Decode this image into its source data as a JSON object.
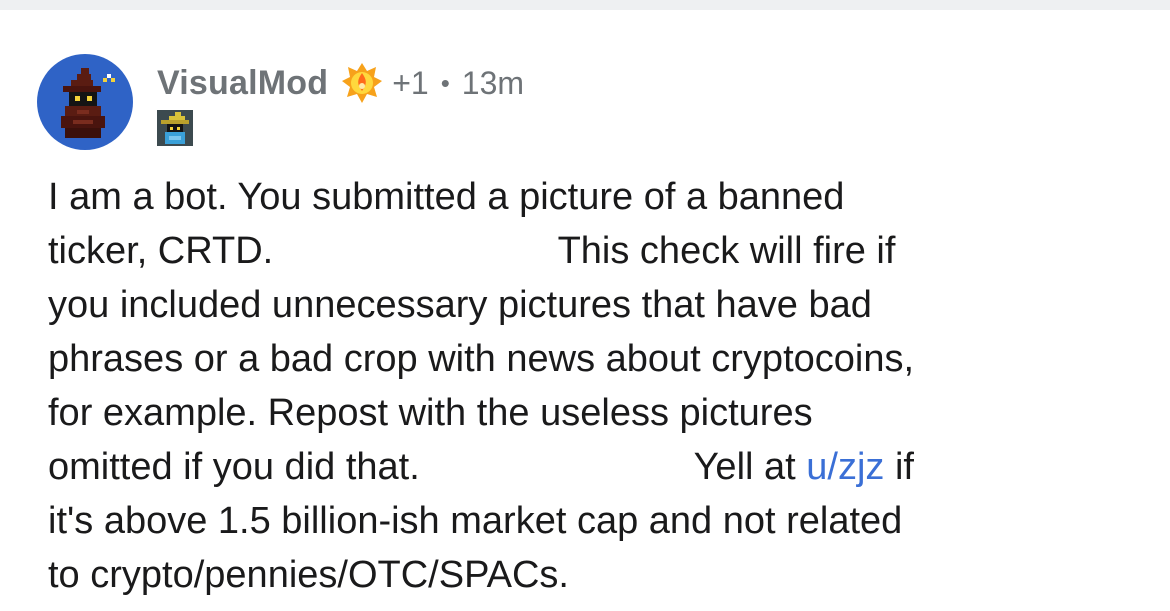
{
  "comment": {
    "username": "VisualMod",
    "award_count": "+1",
    "separator": "•",
    "timestamp": "13m",
    "avatar_icon": "black-mage-avatar-icon",
    "award_icon": "wholesome-seal-award-icon",
    "flair_icon": "black-mage-flair-icon",
    "avatar_bg": "#2f63c6",
    "link_color": "#3a6fd6",
    "body_lines": [
      "I am a bot. You submitted a picture of a banned",
      "ticker, CRTD.                           This check will fire if",
      "you included unnecessary pictures that have bad",
      "phrases or a bad crop with news about cryptocoins,",
      "for example. Repost with the useless pictures",
      "it's above 1.5 billion-ish market cap and not related",
      "to crypto/pennies/OTC/SPACs."
    ],
    "line6_prefix": "omitted if you did that.                          Yell at ",
    "line6_link": "u/zjz",
    "line6_suffix": " if"
  }
}
